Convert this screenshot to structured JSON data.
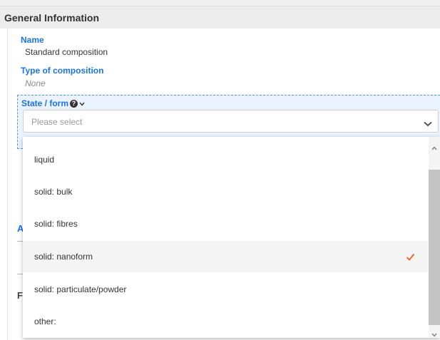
{
  "header": {
    "title": "General Information"
  },
  "fields": {
    "name": {
      "label": "Name",
      "value": "Standard composition"
    },
    "type_of_composition": {
      "label": "Type of composition",
      "value": "None"
    },
    "state_form": {
      "label": "State / form",
      "placeholder": "Please select"
    }
  },
  "dropdown": {
    "options": [
      {
        "label": "liquid",
        "selected": false
      },
      {
        "label": "solid: bulk",
        "selected": false
      },
      {
        "label": "solid: fibres",
        "selected": false
      },
      {
        "label": "solid: nanoform",
        "selected": true
      },
      {
        "label": "solid: particulate/powder",
        "selected": false
      },
      {
        "label": "other:",
        "selected": false
      }
    ]
  },
  "background": {
    "letter_a": "A",
    "letter_f": "F"
  },
  "colors": {
    "label_blue": "#1a73e8",
    "check_orange": "#e8641e",
    "highlight_bg": "#eaf3fd",
    "header_bg": "#ececec"
  },
  "icons": {
    "help": "question-circle-icon",
    "select_chevron": "chevron-down-icon",
    "check": "check-icon"
  }
}
